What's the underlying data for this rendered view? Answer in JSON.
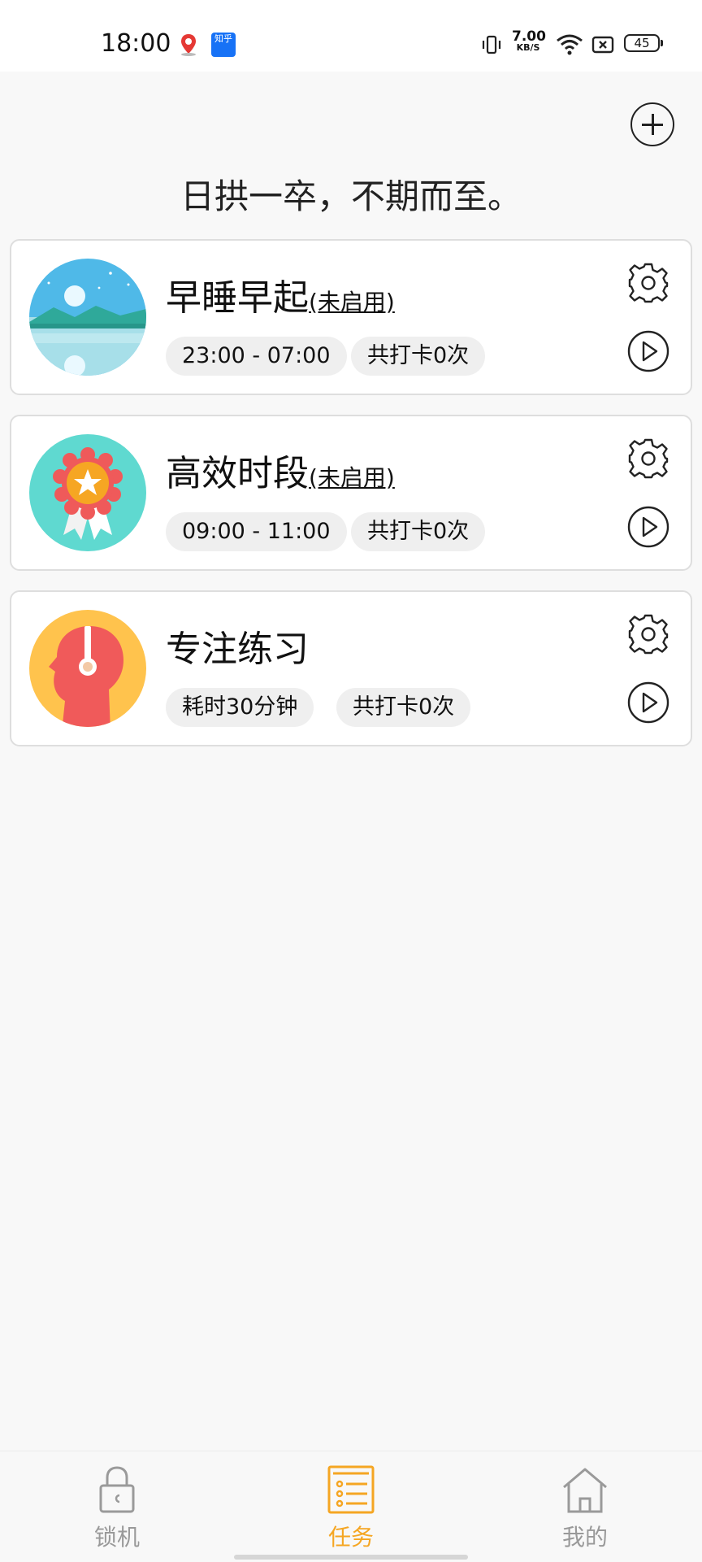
{
  "status_bar": {
    "time": "18:00",
    "app2_label": "知乎",
    "net_speed_value": "7.00",
    "net_speed_unit": "KB/S",
    "battery": "45"
  },
  "header": {
    "slogan": "日拱一卒，不期而至。"
  },
  "tasks": [
    {
      "title": "早睡早起",
      "status": "(未启用)",
      "chips": [
        "23:00 - 07:00",
        "共打卡0次"
      ],
      "icon": "moon-lake-icon"
    },
    {
      "title": "高效时段",
      "status": "(未启用)",
      "chips": [
        "09:00 - 11:00",
        "共打卡0次"
      ],
      "icon": "award-medal-icon"
    },
    {
      "title": "专注练习",
      "status": "",
      "chips": [
        "耗时30分钟",
        "共打卡0次"
      ],
      "icon": "head-headphones-icon"
    }
  ],
  "tabbar": {
    "items": [
      {
        "label": "锁机",
        "icon": "lock-icon",
        "color": "#999999"
      },
      {
        "label": "任务",
        "icon": "task-list-icon",
        "color": "#f5a623"
      },
      {
        "label": "我的",
        "icon": "home-icon",
        "color": "#999999"
      }
    ],
    "active_index": 1
  },
  "colors": {
    "accent": "#f5a623",
    "background": "#f8f8f8",
    "chip": "#efefef"
  }
}
